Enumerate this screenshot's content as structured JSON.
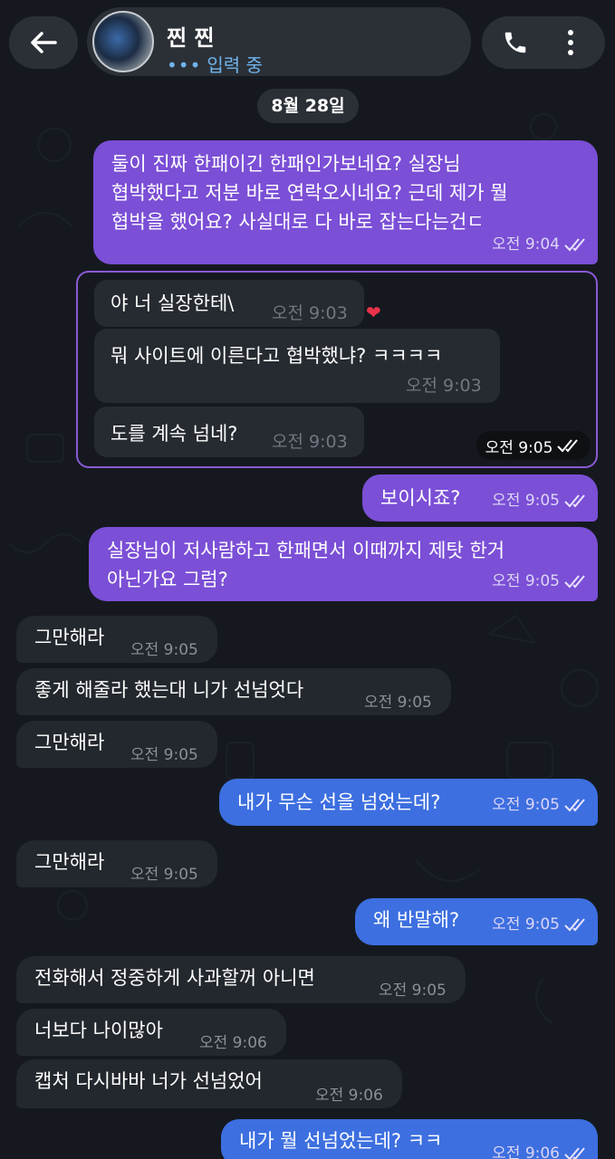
{
  "header": {
    "contact_name": "찐 찐",
    "status_dots": "•••",
    "status": "입력 중"
  },
  "date_label": "8월 28일",
  "forwarded": {
    "messages": [
      {
        "text": "야 너 실장한테\\",
        "time": "오전 9:03"
      },
      {
        "text": "뭐 사이트에 이른다고 협박했냐? ㅋㅋㅋㅋ",
        "time": "오전 9:03"
      },
      {
        "text": "도를 계속 넘네?",
        "time": "오전 9:03"
      }
    ],
    "reaction": "❤",
    "time": "오전 9:05"
  },
  "messages": [
    {
      "dir": "out",
      "lines": [
        "둘이 진짜 한패이긴 한패인가보네요? 실장님",
        "협박했다고 저분 바로 연락오시네요? 근데 제가 뭘",
        "협박을 했어요? 사실대로 다 바로 잡는다는건ㄷ"
      ],
      "time": "오전 9:04"
    },
    {
      "dir": "out",
      "lines": [
        "보이시죠?"
      ],
      "time": "오전 9:05"
    },
    {
      "dir": "out",
      "lines": [
        "실장님이 저사람하고 한패면서 이때까지 제탓 한거",
        "아닌가요 그럼?"
      ],
      "time": "오전 9:05"
    },
    {
      "dir": "in",
      "lines": [
        "그만해라"
      ],
      "time": "오전 9:05"
    },
    {
      "dir": "in",
      "lines": [
        "좋게 해줄라 했는대 니가 선넘엇다"
      ],
      "time": "오전 9:05"
    },
    {
      "dir": "in",
      "lines": [
        "그만해라"
      ],
      "time": "오전 9:05"
    },
    {
      "dir": "out",
      "lines": [
        "내가 무슨 선을 넘었는데?"
      ],
      "time": "오전 9:05"
    },
    {
      "dir": "in",
      "lines": [
        "그만해라"
      ],
      "time": "오전 9:05"
    },
    {
      "dir": "out",
      "lines": [
        "왜 반말해?"
      ],
      "time": "오전 9:05"
    },
    {
      "dir": "in",
      "lines": [
        "전화해서 정중하게 사과할꺼 아니면"
      ],
      "time": "오전 9:05"
    },
    {
      "dir": "in",
      "lines": [
        "너보다 나이많아"
      ],
      "time": "오전 9:06"
    },
    {
      "dir": "in",
      "lines": [
        "캡처 다시바바 너가 선넘었어"
      ],
      "time": "오전 9:06"
    },
    {
      "dir": "out",
      "lines": [
        "내가 뭘 선넘었는데? ㅋㅋ"
      ],
      "time": "오전 9:06"
    }
  ],
  "colors": {
    "background": "#15191f",
    "outgoing_bubble": "#7b4fd6",
    "outgoing_bubble_blue": "#3d6fe0",
    "incoming_bubble": "#23272e",
    "typing_status": "#6fb4ec",
    "forward_border": "#8b5ad6"
  },
  "icons": [
    "back-arrow-icon",
    "phone-icon",
    "more-vertical-icon",
    "double-check-icon",
    "heart-icon"
  ]
}
